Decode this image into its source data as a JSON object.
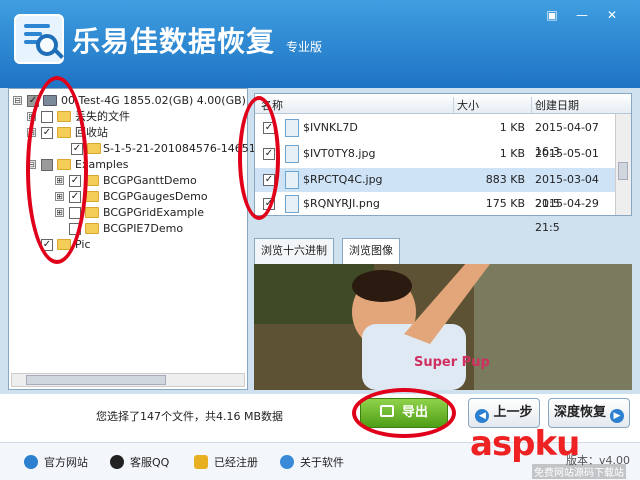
{
  "header": {
    "title": "乐易佳数据恢复",
    "edition": "专业版",
    "buttons": {
      "skin": "▣",
      "minimize": "—",
      "close": "✕"
    }
  },
  "tree": {
    "items": [
      {
        "label": "00 Test-4G  1855.02(GB)  4.00(GB)",
        "expander": "⊟",
        "checked": "✓",
        "state": "partial"
      },
      {
        "label": "丢失的文件",
        "expander": "⊞",
        "checked": "",
        "state": "none"
      },
      {
        "label": "回收站",
        "expander": "⊟",
        "checked": "✓",
        "state": "checked"
      },
      {
        "label": "S-1-5-21-201084576-14651",
        "expander": "",
        "checked": "✓",
        "state": "checked"
      },
      {
        "label": "Examples",
        "expander": "⊟",
        "checked": "",
        "state": "partial"
      },
      {
        "label": "BCGPGanttDemo",
        "expander": "⊞",
        "checked": "✓",
        "state": "checked"
      },
      {
        "label": "BCGPGaugesDemo",
        "expander": "⊞",
        "checked": "✓",
        "state": "checked"
      },
      {
        "label": "BCGPGridExample",
        "expander": "⊞",
        "checked": "",
        "state": "none"
      },
      {
        "label": "BCGPIE7Demo",
        "expander": "",
        "checked": "",
        "state": "none"
      },
      {
        "label": "Pic",
        "expander": "",
        "checked": "✓",
        "state": "checked"
      }
    ]
  },
  "filelist": {
    "headers": {
      "name": "名称",
      "size": "大小",
      "date": "创建日期"
    },
    "rows": [
      {
        "name": "$IVNKL7D",
        "size": "1 KB",
        "date": "2015-04-07  16:3",
        "checked": "✓"
      },
      {
        "name": "$IVT0TY8.jpg",
        "size": "1 KB",
        "date": "2015-05-01  10:1",
        "checked": "✓"
      },
      {
        "name": "$RPCTQ4C.jpg",
        "size": "883 KB",
        "date": "2015-03-04  21:5",
        "checked": "✓"
      },
      {
        "name": "$RQNYRJI.png",
        "size": "175 KB",
        "date": "2015-04-29  21:5",
        "checked": "✓"
      }
    ]
  },
  "tabs": {
    "hex": "浏览十六进制",
    "image": "浏览图像"
  },
  "preview": {
    "shirt_text": "Super Pup"
  },
  "status": {
    "text": "您选择了147个文件，共4.16 MB数据"
  },
  "actions": {
    "export": "导出",
    "prev": "上一步",
    "deep": "深度恢复"
  },
  "footer": {
    "website": "官方网站",
    "qq": "客服QQ",
    "registered": "已经注册",
    "about": "关于软件",
    "version": "版本：v4.00"
  },
  "watermark": {
    "main": "aspku",
    "sub": "免费网站源码下载站"
  }
}
